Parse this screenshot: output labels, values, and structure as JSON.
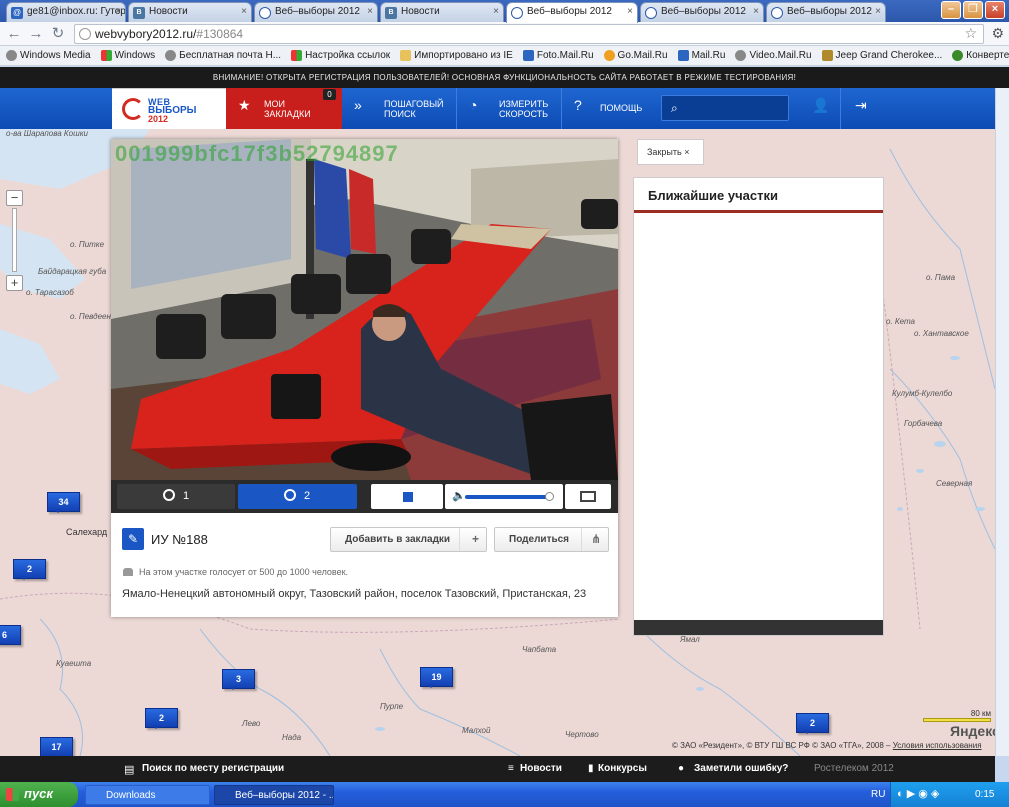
{
  "browser": {
    "tabs": [
      {
        "title": "ge81@inbox.ru: Гутор",
        "icon": "mail-icon"
      },
      {
        "title": "Новости",
        "icon": "vk-icon"
      },
      {
        "title": "Веб–выборы 2012",
        "icon": "webvybory-icon"
      },
      {
        "title": "Новости",
        "icon": "vk-icon"
      },
      {
        "title": "Веб–выборы 2012",
        "icon": "webvybory-icon"
      },
      {
        "title": "Веб–выборы 2012",
        "icon": "webvybory-icon"
      },
      {
        "title": "Веб–выборы 2012",
        "icon": "webvybory-icon"
      }
    ],
    "active_tab": 4,
    "url": "webvybory2012.ru/",
    "url_hash": "#130864",
    "bookmarks": [
      "Windows Media",
      "Windows",
      "Бесплатная почта Н...",
      "Настройка ссылок",
      "Импортировано из IE",
      "Foto.Mail.Ru",
      "Go.Mail.Ru",
      "Mail.Ru",
      "Video.Mail.Ru",
      "Jeep Grand Cherokee...",
      "Конвертер валют"
    ]
  },
  "notice": "ВНИМАНИЕ! ОТКРЫТА РЕГИСТРАЦИЯ ПОЛЬЗОВАТЕЛЕЙ! ОСНОВНАЯ ФУНКЦИОНАЛЬНОСТЬ САЙТА РАБОТАЕТ В РЕЖИМЕ ТЕСТИРОВАНИЯ!",
  "header": {
    "logo": {
      "line1": "WEB",
      "line2": "ВЫБОРЫ",
      "line3": "2012"
    },
    "bookmarks_label": "МОИ ЗАКЛАДКИ",
    "bookmarks_count": "0",
    "search_label": "ПОШАГОВЫЙ ПОИСК",
    "speed_label": "ИЗМЕРИТЬ СКОРОСТЬ",
    "help_label": "ПОМОЩЬ",
    "search_placeholder": ""
  },
  "map": {
    "labels": [
      "о-ва Шарапова Кошки",
      "о. Питке",
      "Байдарацкая губа",
      "о. Тарасазоб",
      "о. Певдеен",
      "Салехард",
      "о. Пама",
      "о. Кета",
      "о. Хантавское",
      "Кулумб-Кулелбо",
      "Горбачева",
      "Северная",
      "Куаешта",
      "Ямал",
      "Чертово",
      "Пурпе",
      "Малхой",
      "Нада",
      "Чапбата",
      "Лево"
    ],
    "markers": [
      {
        "count": "34"
      },
      {
        "count": "2"
      },
      {
        "count": "6"
      },
      {
        "count": "3"
      },
      {
        "count": "19"
      },
      {
        "count": "2"
      },
      {
        "count": "17"
      },
      {
        "count": "2"
      }
    ],
    "scale": "80 км",
    "provider": "Яндекс",
    "copyright": "© ЗАО «Резидент», © ВТУ ГШ ВС РФ © ЗАО «ТГА», 2008 –",
    "terms": "Условия использования"
  },
  "video": {
    "overlay_id": "001999bfc17f3b52794897",
    "cam1": "1",
    "cam2": "2",
    "volume": 0.95
  },
  "polling_station": {
    "title": "ИУ №188",
    "add_bookmark": "Добавить в закладки",
    "share": "Поделиться",
    "voters": "На этом участке голосует от 500 до 1000 человек.",
    "address": "Ямало-Ненецкий автономный округ, Тазовский район, поселок Тазовский, Пристанская, 23"
  },
  "nearest": {
    "close_label": "Закрыть",
    "title": "Ближайшие участки"
  },
  "footer": {
    "search_reg": "Поиск по месту регистрации",
    "news": "Новости",
    "contests": "Конкурсы",
    "report": "Заметили ошибку?",
    "partner": "Ростелеком 2012"
  },
  "taskbar": {
    "start": "пуск",
    "tasks": [
      "Downloads",
      "Веб–выборы 2012 - ..."
    ],
    "lang": "RU",
    "time": "0:15"
  }
}
